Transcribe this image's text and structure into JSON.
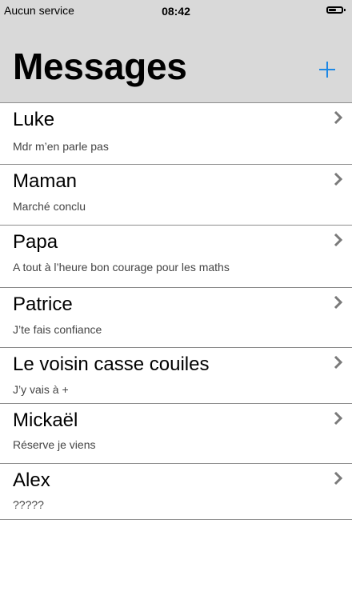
{
  "status_bar": {
    "carrier": "Aucun service",
    "time": "08:42",
    "battery_level": 0.7
  },
  "header": {
    "title": "Messages",
    "add_icon": "plus-icon",
    "accent_color": "#1e88e5"
  },
  "conversations": [
    {
      "name": "Luke",
      "preview": "Mdr m’en parle pas"
    },
    {
      "name": "Maman",
      "preview": "Marché conclu"
    },
    {
      "name": "Papa",
      "preview": "A tout à l’heure bon courage pour les maths"
    },
    {
      "name": "Patrice",
      "preview": "J’te fais confiance"
    },
    {
      "name": "Le voisin casse couiles",
      "preview": "J’y vais à +"
    },
    {
      "name": "Mickaël",
      "preview": "Réserve je viens"
    },
    {
      "name": "Alex",
      "preview": "?????"
    }
  ],
  "row_icon": "chevron-right-icon"
}
